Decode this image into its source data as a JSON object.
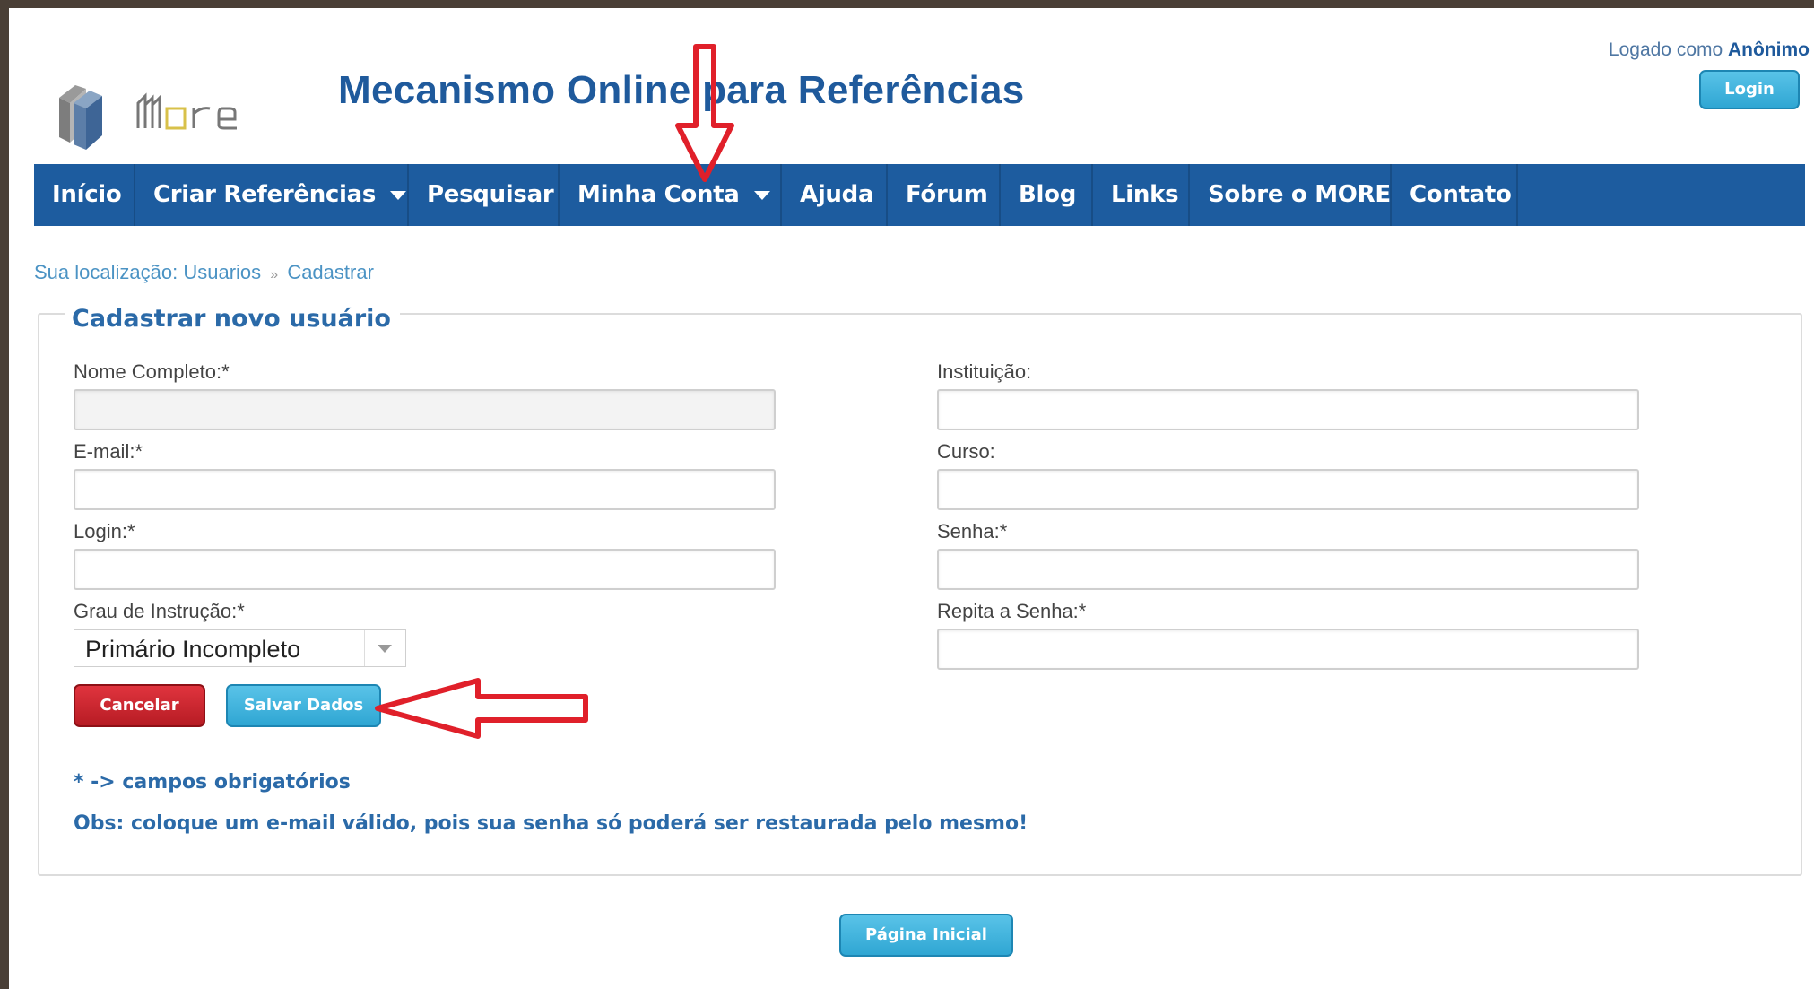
{
  "header": {
    "site_title": "Mecanismo Online para Referências",
    "logo_text": "more",
    "logged_as_prefix": "Logado como ",
    "logged_as_user": "Anônimo",
    "login_label": "Login"
  },
  "nav": {
    "items": [
      {
        "label": "Início"
      },
      {
        "label": "Criar Referências"
      },
      {
        "label": "Pesquisar"
      },
      {
        "label": "Minha Conta"
      },
      {
        "label": "Ajuda"
      },
      {
        "label": "Fórum"
      },
      {
        "label": "Blog"
      },
      {
        "label": "Links"
      },
      {
        "label": "Sobre o MORE"
      },
      {
        "label": "Contato"
      }
    ]
  },
  "breadcrumb": {
    "prefix": "Sua localização:",
    "item1": "Usuarios",
    "separator": "»",
    "item2": "Cadastrar"
  },
  "form": {
    "legend": "Cadastrar novo usuário",
    "fields": {
      "nome": {
        "label": "Nome Completo:*",
        "value": ""
      },
      "email": {
        "label": "E-mail:*",
        "value": ""
      },
      "login": {
        "label": "Login:*",
        "value": ""
      },
      "grau": {
        "label": "Grau de Instrução:*",
        "value": "Primário Incompleto"
      },
      "instituicao": {
        "label": "Instituição:",
        "value": ""
      },
      "curso": {
        "label": "Curso:",
        "value": ""
      },
      "senha": {
        "label": "Senha:*",
        "value": ""
      },
      "repita_senha": {
        "label": "Repita a Senha:*",
        "value": ""
      }
    },
    "cancel_label": "Cancelar",
    "save_label": "Salvar Dados",
    "required_note": "* -> campos obrigatórios",
    "obs_note": "Obs: coloque um e-mail válido, pois sua senha só poderá ser restaurada pelo mesmo!"
  },
  "footer": {
    "home_label": "Página Inicial"
  },
  "colors": {
    "nav_bg": "#1d5c9f",
    "title": "#1f5a9c",
    "button_blue": "#2fa6d3",
    "button_red": "#c4222b",
    "annotation_red": "#e0202a"
  }
}
